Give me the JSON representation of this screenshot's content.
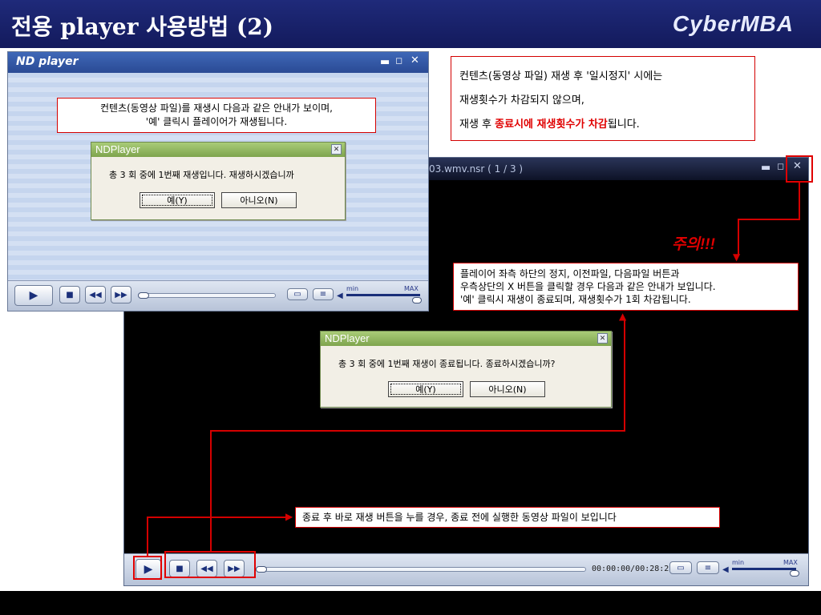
{
  "header": {
    "title": "전용 player 사용방법 (2)",
    "logo": "CyberMBA"
  },
  "big_player": {
    "title": "03.wmv.nsr ( 1 / 3 )",
    "time": "00:00:00/00:28:23",
    "vol_min": "min",
    "vol_max": "MAX"
  },
  "small_player": {
    "logo": "ND player",
    "vol_min": "min",
    "vol_max": "MAX"
  },
  "dialog1": {
    "title": "NDPlayer",
    "message": "총 3 회 중에 1번째 재생입니다. 재생하시겠습니까",
    "yes": "예(Y)",
    "no": "아니오(N)"
  },
  "dialog2": {
    "title": "NDPlayer",
    "message": "총 3 회 중에 1번째 재생이 종료됩니다. 종료하시겠습니까?",
    "yes": "예(Y)",
    "no": "아니오(N)"
  },
  "callouts": {
    "top_left_line1": "컨텐츠(동영상 파일)를 재생시 다음과 같은 안내가 보이며,",
    "top_left_line2": "'예' 클릭시 플레이어가 재생됩니다.",
    "top_right_line1": "컨텐츠(동영상 파일) 재생 후 '일시정지' 시에는",
    "top_right_line2": "재생횟수가 차감되지 않으며,",
    "top_right_line3_a": "재생 후 ",
    "top_right_line3_b": "종료시에 재생횟수가 차감",
    "top_right_line3_c": "됩니다.",
    "warning": "주의!!!",
    "mid_right_line1": "플레이어 좌측 하단의 정지, 이전파일, 다음파일 버튼과",
    "mid_right_line2": "우측상단의 X 버튼을 클릭할 경우 다음과 같은 안내가 보입니다.",
    "mid_right_line3": "'예' 클릭시 재생이 종료되며, 재생횟수가 1회 차감됩니다.",
    "bottom": "종료 후 바로 재생 버튼을 누를 경우, 종료 전에 실행한 동영상 파일이 보입니다"
  },
  "colors": {
    "header_bg": "#131a5c",
    "accent_red": "#e00000",
    "dialog_bar": "#7ea44d"
  }
}
